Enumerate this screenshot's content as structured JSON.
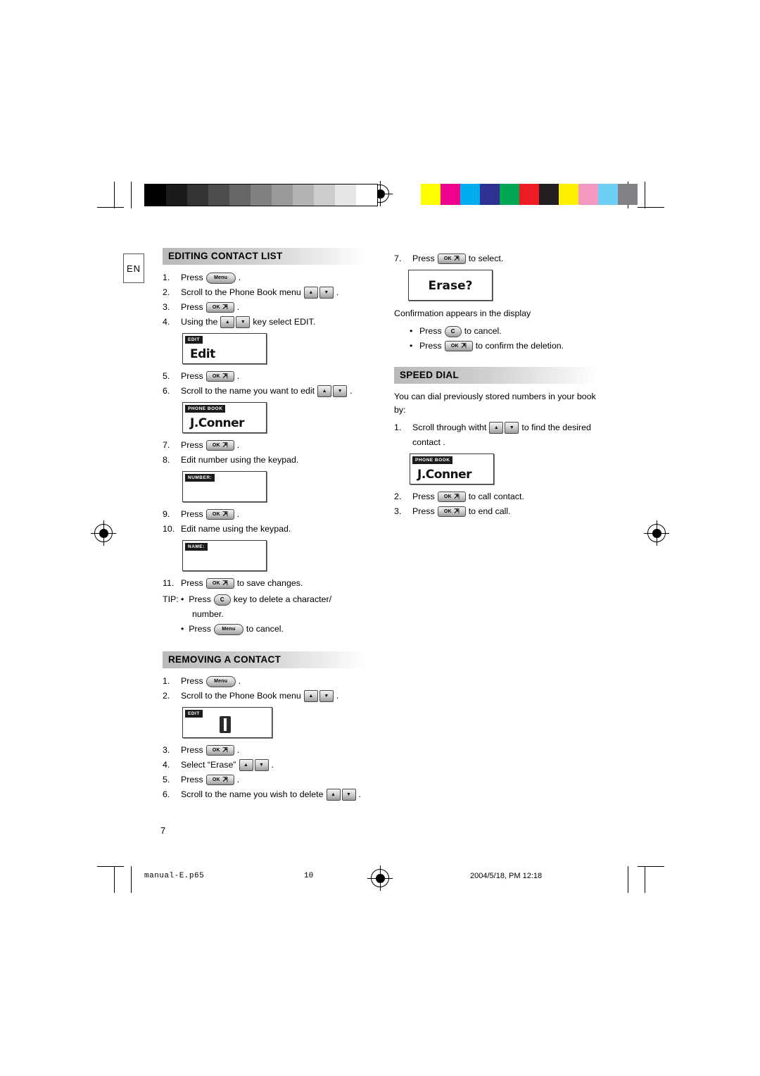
{
  "document": {
    "language_tab": "EN",
    "page_number": "7",
    "footer": {
      "filename": "manual-E.p65",
      "sheet": "10",
      "timestamp": "2004/5/18, PM 12:18"
    }
  },
  "sections": {
    "editing_contact_list": {
      "title": "EDITING CONTACT LIST",
      "steps": [
        {
          "num": "1.",
          "pre": "Press",
          "key": "menu",
          "post": "."
        },
        {
          "num": "2.",
          "pre": "Scroll to the Phone Book menu",
          "key": "updown",
          "post": "."
        },
        {
          "num": "3.",
          "pre": "Press",
          "key": "ok",
          "post": "."
        },
        {
          "num": "4.",
          "pre": "Using the",
          "key": "updown",
          "post": "key select EDIT."
        },
        {
          "num": "5.",
          "pre": "Press",
          "key": "ok",
          "post": "."
        },
        {
          "num": "6.",
          "pre": "Scroll to the name you want to edit",
          "key": "updown",
          "post": "."
        },
        {
          "num": "7.",
          "pre": "Press",
          "key": "ok",
          "post": "."
        },
        {
          "num": "8.",
          "pre": "Edit number using the keypad.",
          "key": "",
          "post": ""
        },
        {
          "num": "9.",
          "pre": "Press",
          "key": "ok",
          "post": "."
        },
        {
          "num": "10.",
          "pre": "Edit name using the keypad.",
          "key": "",
          "post": ""
        },
        {
          "num": "11.",
          "pre": "Press",
          "key": "ok",
          "post": "to save changes."
        }
      ],
      "screens": {
        "edit": {
          "title": "EDIT",
          "text": "Edit"
        },
        "phonebook_name": {
          "title": "PHONE BOOK",
          "text": "J.Conner"
        },
        "number": {
          "title": "NUMBER:",
          "text": ""
        },
        "name": {
          "title": "NAME:",
          "text": ""
        }
      },
      "tip": {
        "label": "TIP:",
        "items": [
          {
            "pre": "Press",
            "key": "c",
            "post": "key to delete a character/"
          },
          {
            "pre": "number.",
            "key": "",
            "post": ""
          },
          {
            "pre": "Press",
            "key": "menu",
            "post": "to cancel."
          }
        ]
      }
    },
    "removing_a_contact": {
      "title": "REMOVING A CONTACT",
      "steps": [
        {
          "num": "1.",
          "pre": "Press",
          "key": "menu",
          "post": "."
        },
        {
          "num": "2.",
          "pre": "Scroll to the Phone Book menu",
          "key": "updown",
          "post": "."
        },
        {
          "num": "3.",
          "pre": "Press",
          "key": "ok",
          "post": "."
        },
        {
          "num": "4.",
          "pre": "Select “Erase”",
          "key": "updown",
          "post": "."
        },
        {
          "num": "5.",
          "pre": "Press",
          "key": "ok",
          "post": "."
        },
        {
          "num": "6.",
          "pre": "Scroll to the name you wish to delete",
          "key": "updown",
          "post": "."
        },
        {
          "num": "7.",
          "pre": "Press",
          "key": "ok",
          "post": "to select."
        }
      ],
      "screens": {
        "phonebook_icon": {
          "title": "EDIT",
          "text": ""
        },
        "erase": {
          "title": "",
          "text": "Erase?"
        }
      },
      "confirmation_text": "Confirmation appears in the display",
      "confirm_items": [
        {
          "pre": "Press",
          "key": "c",
          "post": "to cancel."
        },
        {
          "pre": "Press",
          "key": "ok",
          "post": "to confirm the deletion."
        }
      ]
    },
    "speed_dial": {
      "title": "SPEED DIAL",
      "intro": "You can dial previously stored numbers in your book by:",
      "steps": [
        {
          "num": "1.",
          "pre": "Scroll through witht",
          "key": "updown",
          "post": "to find the desired"
        },
        {
          "num": "",
          "pre": "contact .",
          "key": "",
          "post": ""
        },
        {
          "num": "2.",
          "pre": "Press",
          "key": "ok",
          "post": "to call contact."
        },
        {
          "num": "3.",
          "pre": "Press",
          "key": "ok",
          "post": "to end call."
        }
      ],
      "screens": {
        "phonebook_name": {
          "title": "PHONE BOOK",
          "text": "J.Conner"
        }
      }
    }
  },
  "keys": {
    "menu_label": "Menu",
    "ok_label": "OK",
    "c_label": "C",
    "up_glyph": "▲",
    "down_glyph": "▼"
  },
  "print_bars": {
    "grayscale": [
      "#000000",
      "#1a1a1a",
      "#333333",
      "#4d4d4d",
      "#666666",
      "#808080",
      "#999999",
      "#b3b3b3",
      "#cccccc",
      "#e6e6e6",
      "#ffffff"
    ],
    "colors": [
      "#ffff00",
      "#ec008c",
      "#00aeef",
      "#2e3192",
      "#00a651",
      "#ed1c24",
      "#231f20",
      "#fff200",
      "#f49ac1",
      "#6dcff6",
      "#808285"
    ]
  }
}
